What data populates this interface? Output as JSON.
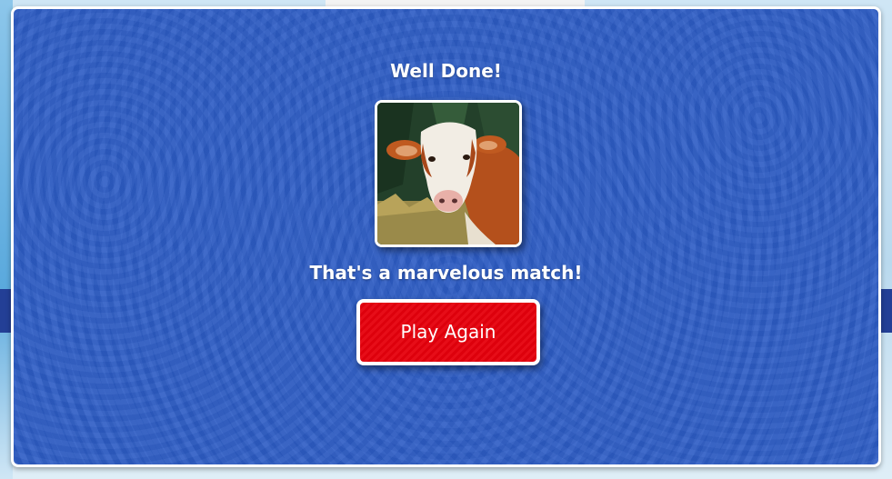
{
  "modal": {
    "title": "Well Done!",
    "card_image": "cow",
    "message": "That's a marvelous match!",
    "play_again_label": "Play Again"
  },
  "colors": {
    "modal_background": "#2d5cc4",
    "button": "#e6000c",
    "text": "#ffffff",
    "navbar": "#233f96"
  }
}
